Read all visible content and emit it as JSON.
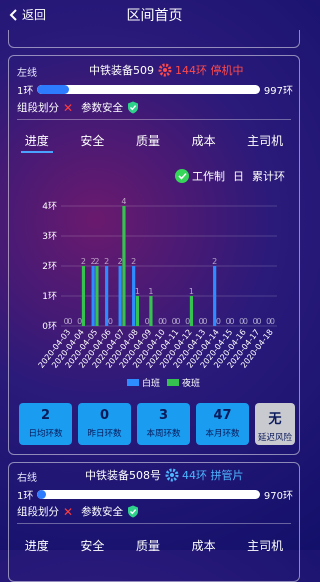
{
  "header": {
    "back_label": "返回",
    "title": "区间首页"
  },
  "card1": {
    "side": "左线",
    "machine": "中铁装备509",
    "status": "144环 停机中",
    "progress": {
      "start": "1环",
      "end": "997环",
      "fraction": 0.144
    },
    "flags": {
      "zone": "组段划分",
      "safety": "参数安全"
    },
    "tabs": [
      "进度",
      "安全",
      "质量",
      "成本",
      "主司机"
    ],
    "filter": {
      "mode": "工作制",
      "day": "日",
      "cum": "累计环"
    },
    "stats": [
      {
        "value": "2",
        "label": "日均环数"
      },
      {
        "value": "0",
        "label": "昨日环数"
      },
      {
        "value": "3",
        "label": "本周环数"
      },
      {
        "value": "47",
        "label": "本月环数"
      },
      {
        "value": "无",
        "label": "延迟风险"
      }
    ]
  },
  "card2": {
    "side": "右线",
    "machine": "中铁装备508号",
    "status": "44环 拼管片",
    "progress": {
      "start": "1环",
      "end": "970环",
      "fraction": 0.044
    },
    "flags": {
      "zone": "组段划分",
      "safety": "参数安全"
    },
    "tabs": [
      "进度",
      "安全",
      "质量",
      "成本",
      "主司机"
    ]
  },
  "colors": {
    "day": "#2d8cff",
    "night": "#36c24f",
    "stop": "#ff4a4a",
    "active": "#4db6ff"
  },
  "chart_data": {
    "type": "bar",
    "categories": [
      "2020-04-03",
      "2020-04-04",
      "2020-04-05",
      "2020-04-06",
      "2020-04-07",
      "2020-04-08",
      "2020-04-09",
      "2020-04-10",
      "2020-04-11",
      "2020-04-12",
      "2020-04-13",
      "2020-04-14",
      "2020-04-15",
      "2020-04-16",
      "2020-04-17",
      "2020-04-18"
    ],
    "series": [
      {
        "name": "白班",
        "values": [
          0,
          0,
          2,
          2,
          2,
          2,
          0,
          0,
          0,
          0,
          0,
          2,
          0,
          0,
          0,
          0
        ]
      },
      {
        "name": "夜班",
        "values": [
          0,
          2,
          2,
          0,
          4,
          1,
          1,
          0,
          0,
          1,
          0,
          0,
          0,
          0,
          0,
          0
        ]
      }
    ],
    "yticks": [
      "0环",
      "1环",
      "2环",
      "3环",
      "4环"
    ],
    "ylim": [
      0,
      4
    ],
    "legend": "bottom"
  }
}
